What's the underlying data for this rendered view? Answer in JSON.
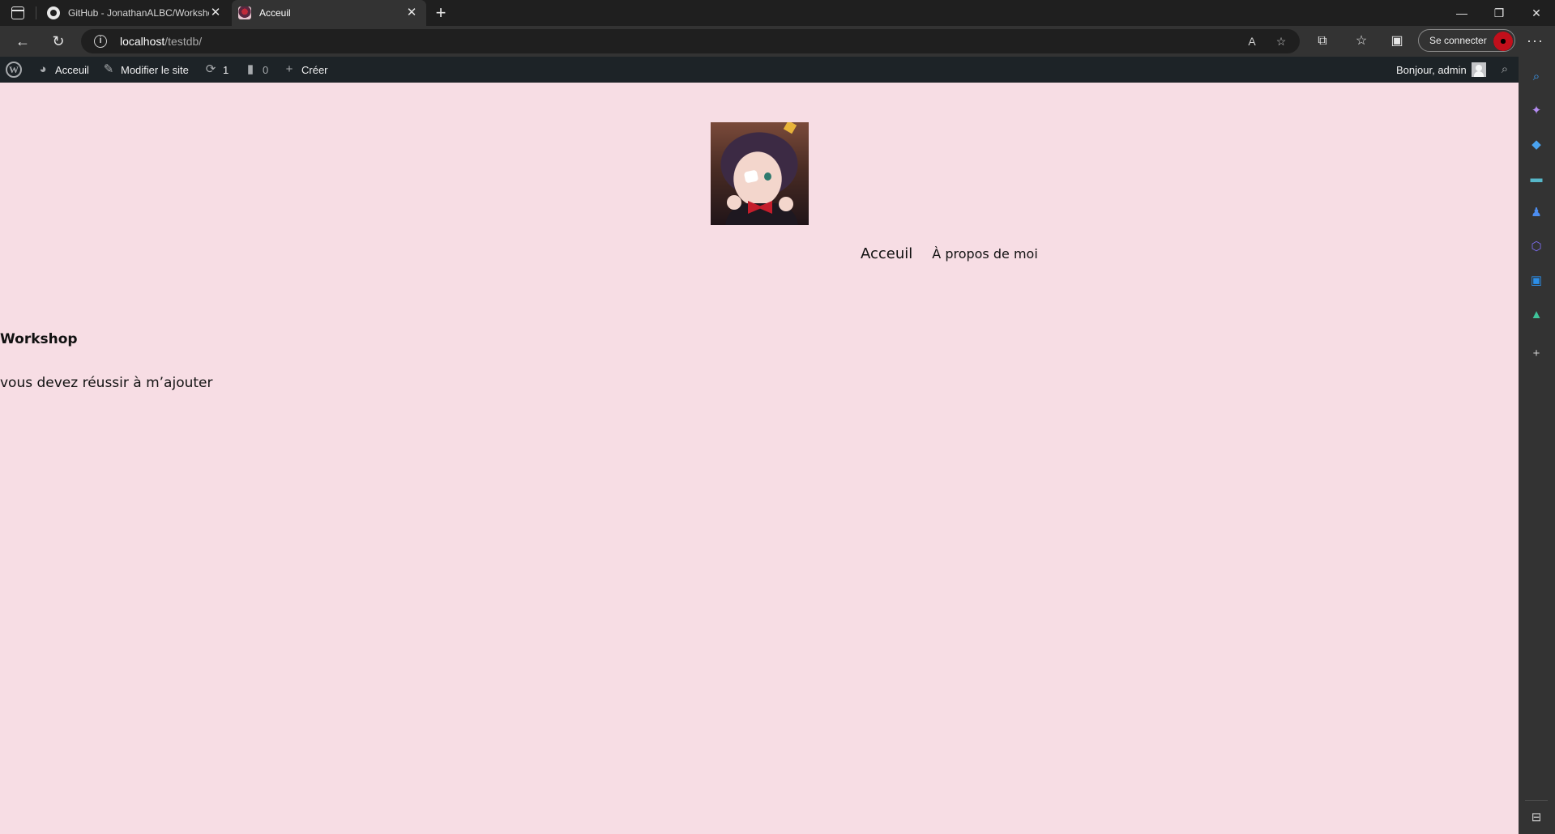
{
  "browser": {
    "tabs": [
      {
        "title": "GitHub - JonathanALBC/Worksho",
        "active": false
      },
      {
        "title": "Acceuil",
        "active": true
      }
    ],
    "url": {
      "host": "localhost",
      "path": "/testdb/"
    },
    "sign_in_label": "Se connecter"
  },
  "admin_bar": {
    "home_label": "Acceuil",
    "edit_site_label": "Modifier le site",
    "updates_count": "1",
    "comments_count": "0",
    "create_label": "Créer",
    "greeting": "Bonjour, admin"
  },
  "site": {
    "nav": [
      {
        "label": "Acceuil"
      },
      {
        "label": "À propos de moi"
      }
    ],
    "post": {
      "title": "Workshop",
      "text": "vous devez réussir à m’ajouter"
    }
  },
  "colors": {
    "page_background": "#f7dde4",
    "admin_bar": "#1d2327",
    "browser_chrome": "#333333"
  }
}
